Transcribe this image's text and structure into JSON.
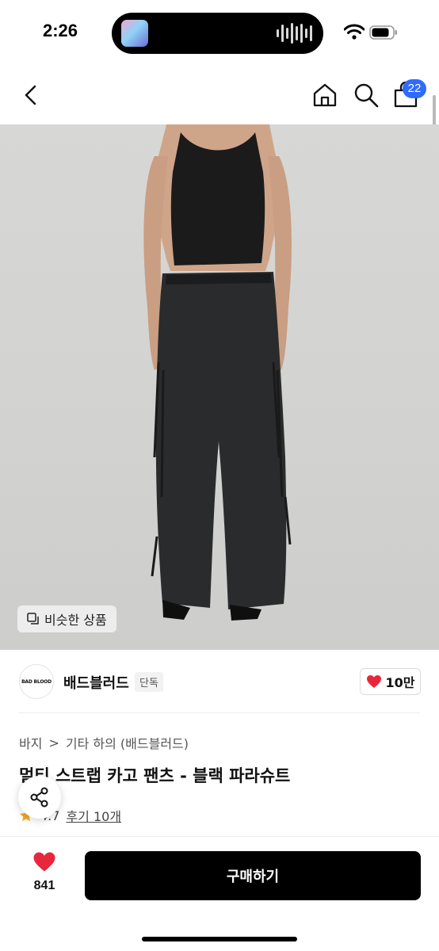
{
  "status_bar": {
    "time": "2:26"
  },
  "nav": {
    "cart_count": "22"
  },
  "image": {
    "similar_label": "비슷한 상품"
  },
  "brand": {
    "logo_text": "BAD BLOOD",
    "name": "배드블러드",
    "exclusive": "단독",
    "likes": "10만"
  },
  "breadcrumb": {
    "category": "바지",
    "separator": ">",
    "subcategory": "기타 하의 (배드블러드)"
  },
  "product": {
    "title": "멀티 스트랩 카고 팬츠 - 블랙 파라슈트",
    "rating": "4.7",
    "reviews": "후기 10개"
  },
  "bottom": {
    "wish_count": "841",
    "buy_label": "구매하기"
  },
  "icons": [
    "back-icon",
    "home-icon",
    "search-icon",
    "cart-icon",
    "heart-icon",
    "share-icon",
    "star-icon",
    "wifi-icon",
    "battery-icon",
    "copy-icon"
  ],
  "colors": {
    "badge_blue": "#2f6bff",
    "heart_red": "#e8263c",
    "star_orange": "#f5a623"
  }
}
